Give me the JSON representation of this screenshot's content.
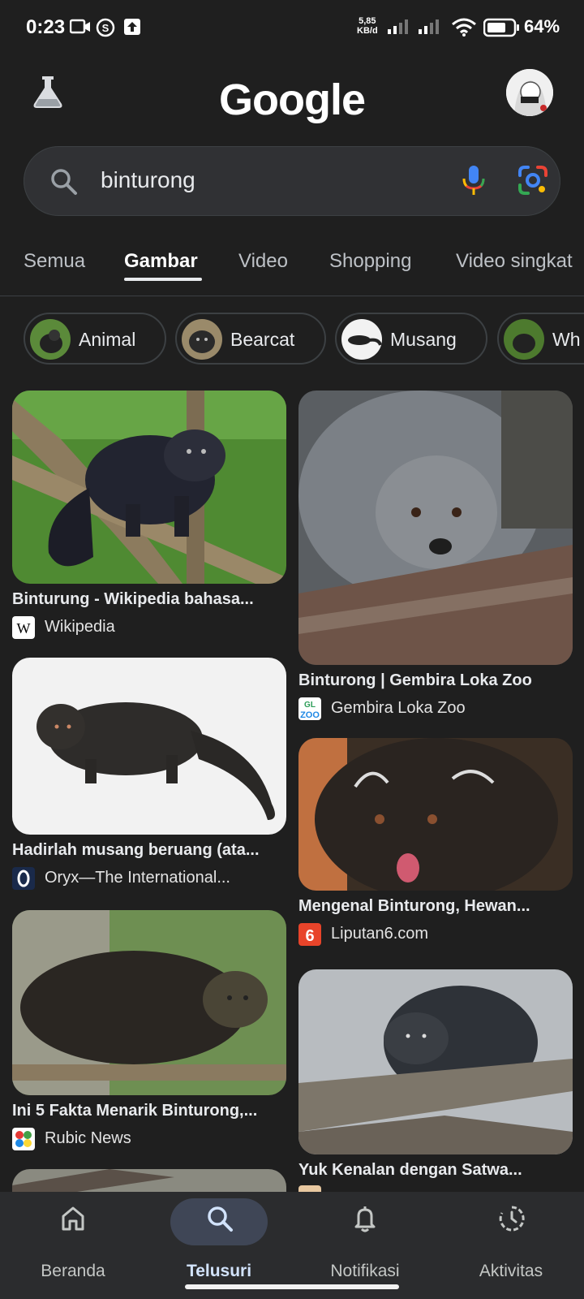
{
  "status_bar": {
    "time": "0:23",
    "net_speed_value": "5,85",
    "net_speed_unit": "KB/d",
    "battery": "64%",
    "icons": [
      "video-camera-icon",
      "s-circle-icon",
      "upload-icon",
      "signal-icon",
      "signal-icon",
      "wifi-icon",
      "battery-icon"
    ]
  },
  "header": {
    "logo": "Google",
    "labs_icon": "flask-icon",
    "avatar_icon": "avatar"
  },
  "search": {
    "query": "binturong",
    "icons": [
      "search-icon",
      "mic-icon",
      "lens-icon"
    ]
  },
  "tabs": [
    "Semua",
    "Gambar",
    "Video",
    "Shopping",
    "Video singkat"
  ],
  "active_tab": "Gambar",
  "chips": [
    "Animal",
    "Bearcat",
    "Musang",
    "Wh"
  ],
  "results": {
    "left": [
      {
        "title": "Binturung - Wikipedia bahasa...",
        "source": "Wikipedia"
      },
      {
        "title": "Hadirlah musang beruang (ata...",
        "source": "Oryx—The International..."
      },
      {
        "title": "Ini 5 Fakta Menarik Binturong,...",
        "source": "Rubic News"
      }
    ],
    "right": [
      {
        "title": "Binturong | Gembira Loka Zoo",
        "source": "Gembira Loka Zoo"
      },
      {
        "title": "Mengenal Binturong, Hewan...",
        "source": "Liputan6.com"
      },
      {
        "title": "Yuk Kenalan dengan Satwa...",
        "source": ""
      }
    ]
  },
  "bottom_nav": {
    "items": [
      {
        "label": "Beranda",
        "icon": "home-icon"
      },
      {
        "label": "Telusuri",
        "icon": "search-icon"
      },
      {
        "label": "Notifikasi",
        "icon": "bell-icon"
      },
      {
        "label": "Aktivitas",
        "icon": "history-icon"
      }
    ],
    "active": "Telusuri"
  },
  "colors": {
    "background": "#1f1f1f",
    "search_bg": "#303134",
    "nav_bg": "#2b2c2e",
    "active_pill": "#3f4656"
  }
}
